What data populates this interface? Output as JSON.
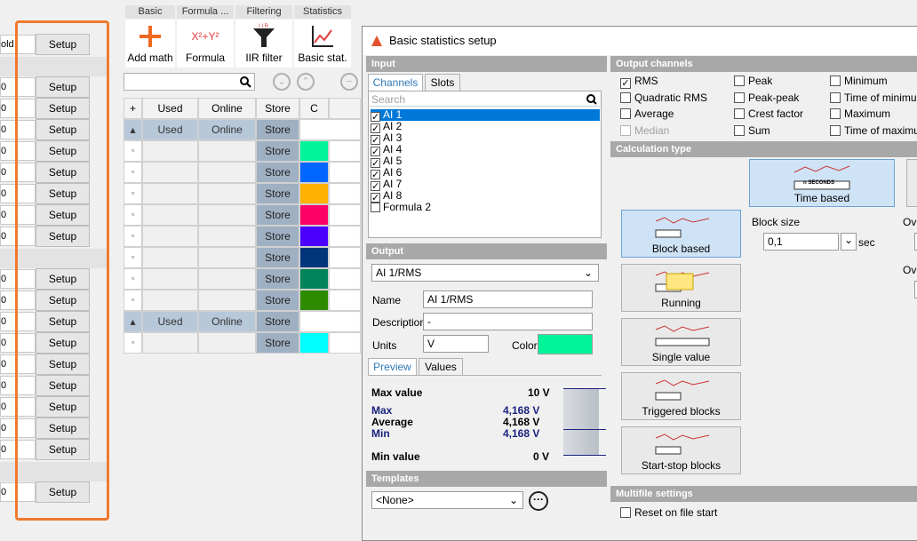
{
  "left_panel": {
    "row_values": [
      "old",
      "",
      "0",
      "0",
      "0",
      "0",
      "0",
      "0",
      "0",
      "0",
      "",
      "0",
      "0",
      "0",
      "0",
      "0",
      "0",
      "0",
      "0",
      "0",
      "",
      "0"
    ],
    "setup_label": "Setup"
  },
  "ribbon": {
    "groups": [
      {
        "title": "Basic",
        "button": "Add math"
      },
      {
        "title": "Formula ...",
        "button": "Formula"
      },
      {
        "title": "Filtering",
        "button": "IIR filter"
      },
      {
        "title": "Statistics",
        "button": "Basic stat."
      }
    ],
    "formula_icon_text": "X²+Y²"
  },
  "grid": {
    "columns": [
      "+",
      "Used",
      "Online",
      "Store",
      "C"
    ],
    "group_row": {
      "used": "Used",
      "online": "Online",
      "store": "Store"
    },
    "store_label": "Store",
    "colors": [
      "#00f59a",
      "#0066ff",
      "#ffb000",
      "#ff0066",
      "#4b00ff",
      "#00357a",
      "#00835a",
      "#2e8b00",
      "#00ffff"
    ]
  },
  "dialog": {
    "title": "Basic statistics setup",
    "input": {
      "header": "Input",
      "tabs": [
        "Channels",
        "Slots"
      ],
      "search_placeholder": "Search",
      "channels": [
        {
          "name": "AI 1",
          "checked": true,
          "selected": true
        },
        {
          "name": "AI 2",
          "checked": true
        },
        {
          "name": "AI 3",
          "checked": true
        },
        {
          "name": "AI 4",
          "checked": true
        },
        {
          "name": "AI 5",
          "checked": true
        },
        {
          "name": "AI 6",
          "checked": true
        },
        {
          "name": "AI 7",
          "checked": true
        },
        {
          "name": "AI 8",
          "checked": true
        },
        {
          "name": "Formula 2",
          "checked": false
        }
      ]
    },
    "output": {
      "header": "Output",
      "selected": "AI 1/RMS",
      "name_label": "Name",
      "name_value": "AI 1/RMS",
      "description_label": "Description",
      "description_value": "-",
      "units_label": "Units",
      "units_value": "V",
      "color_label": "Color",
      "color_value": "#00f59a",
      "tabs": [
        "Preview",
        "Values"
      ],
      "preview": {
        "max_value_label": "Max value",
        "max_value": "10 V",
        "max_label": "Max",
        "max": "4,168 V",
        "average_label": "Average",
        "average": "4,168 V",
        "min_label": "Min",
        "min": "4,168 V",
        "min_value_label": "Min value",
        "min_value": "0 V"
      }
    },
    "templates": {
      "header": "Templates",
      "selected": "<None>"
    },
    "output_channels": {
      "header": "Output channels",
      "items": [
        {
          "label": "RMS",
          "checked": true
        },
        {
          "label": "Peak",
          "checked": false
        },
        {
          "label": "Minimum",
          "checked": false
        },
        {
          "label": "Quadratic RMS",
          "checked": false
        },
        {
          "label": "Peak-peak",
          "checked": false
        },
        {
          "label": "Time of minimum",
          "checked": false
        },
        {
          "label": "Average",
          "checked": false
        },
        {
          "label": "Crest factor",
          "checked": false
        },
        {
          "label": "Maximum",
          "checked": false
        },
        {
          "label": "Median",
          "checked": false,
          "disabled": true
        },
        {
          "label": "Sum",
          "checked": false
        },
        {
          "label": "Time of maximum",
          "checked": false
        }
      ]
    },
    "calculation_type": {
      "header": "Calculation type",
      "time_based": "Time based",
      "time_icon_text": "n SECONDS",
      "options": [
        "Block based",
        "Running",
        "Single value",
        "Triggered blocks",
        "Start-stop blocks"
      ],
      "block_size_label": "Block size",
      "block_size_value": "0,1",
      "block_size_unit": "sec",
      "ove_label": "Ove"
    },
    "multifile": {
      "header": "Multifile settings",
      "reset_label": "Reset on file start"
    }
  }
}
